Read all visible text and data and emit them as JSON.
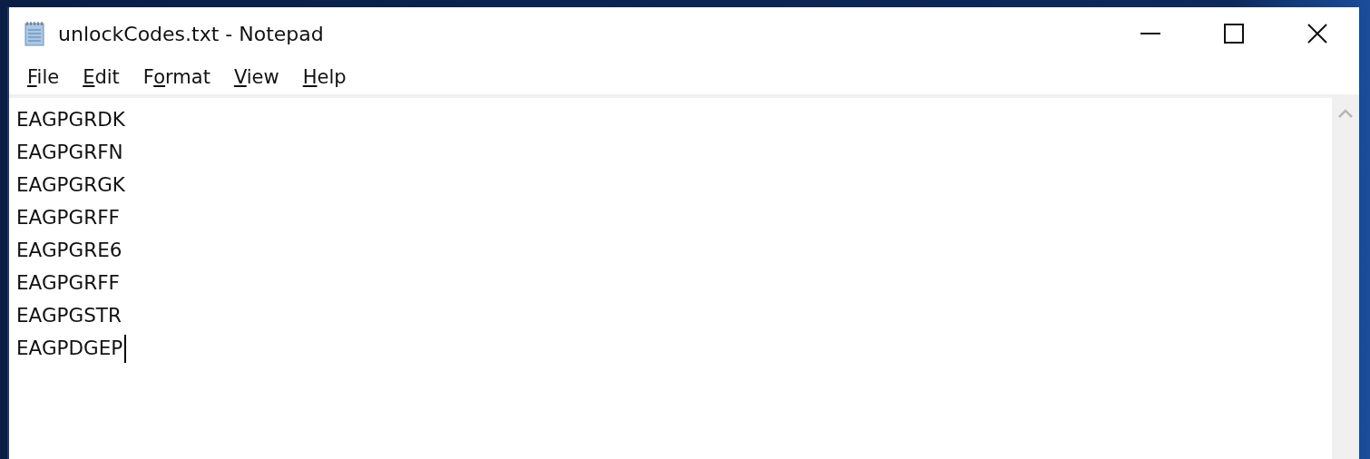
{
  "window": {
    "title": "unlockCodes.txt - Notepad"
  },
  "menu": [
    {
      "parts": [
        {
          "text": "F",
          "underlined": true
        },
        {
          "text": "ile",
          "underlined": false
        }
      ]
    },
    {
      "parts": [
        {
          "text": "E",
          "underlined": true
        },
        {
          "text": "dit",
          "underlined": false
        }
      ]
    },
    {
      "parts": [
        {
          "text": "F",
          "underlined": false
        },
        {
          "text": "o",
          "underlined": true
        },
        {
          "text": "rmat",
          "underlined": false
        }
      ]
    },
    {
      "parts": [
        {
          "text": "V",
          "underlined": true
        },
        {
          "text": "iew",
          "underlined": false
        }
      ]
    },
    {
      "parts": [
        {
          "text": "H",
          "underlined": true
        },
        {
          "text": "elp",
          "underlined": false
        }
      ]
    }
  ],
  "editor": {
    "lines": [
      "EAGPGRDK",
      "EAGPGRFN",
      "EAGPGRGK",
      "EAGPGRFF",
      "EAGPGRE6",
      "EAGPGRFF",
      "EAGPGSTR",
      "EAGPDGEP"
    ],
    "caret_at_end": true
  }
}
